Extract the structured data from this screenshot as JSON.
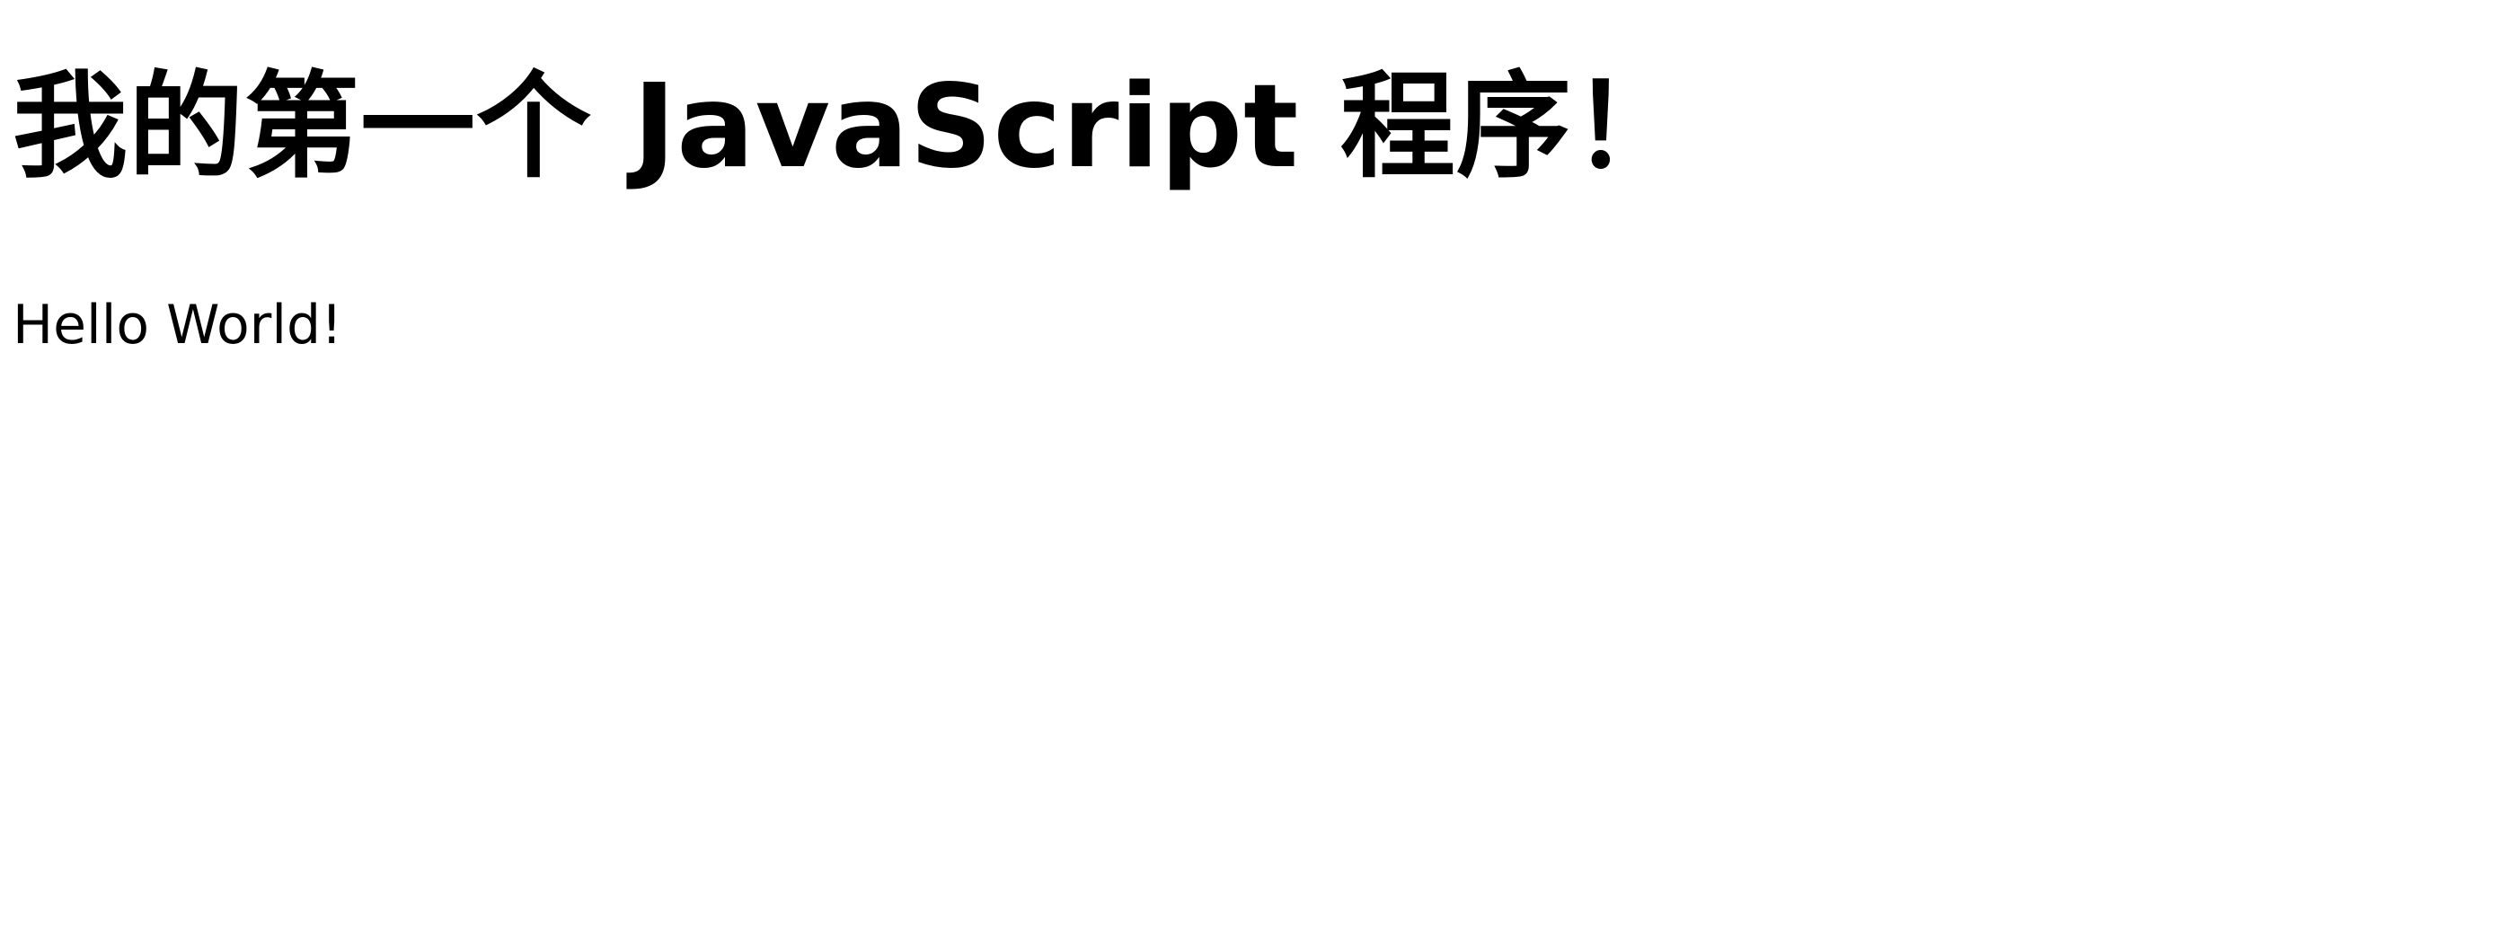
{
  "heading": {
    "text": "我的第一个 JavaScript 程序！"
  },
  "paragraph": {
    "text": "Hello World!"
  }
}
